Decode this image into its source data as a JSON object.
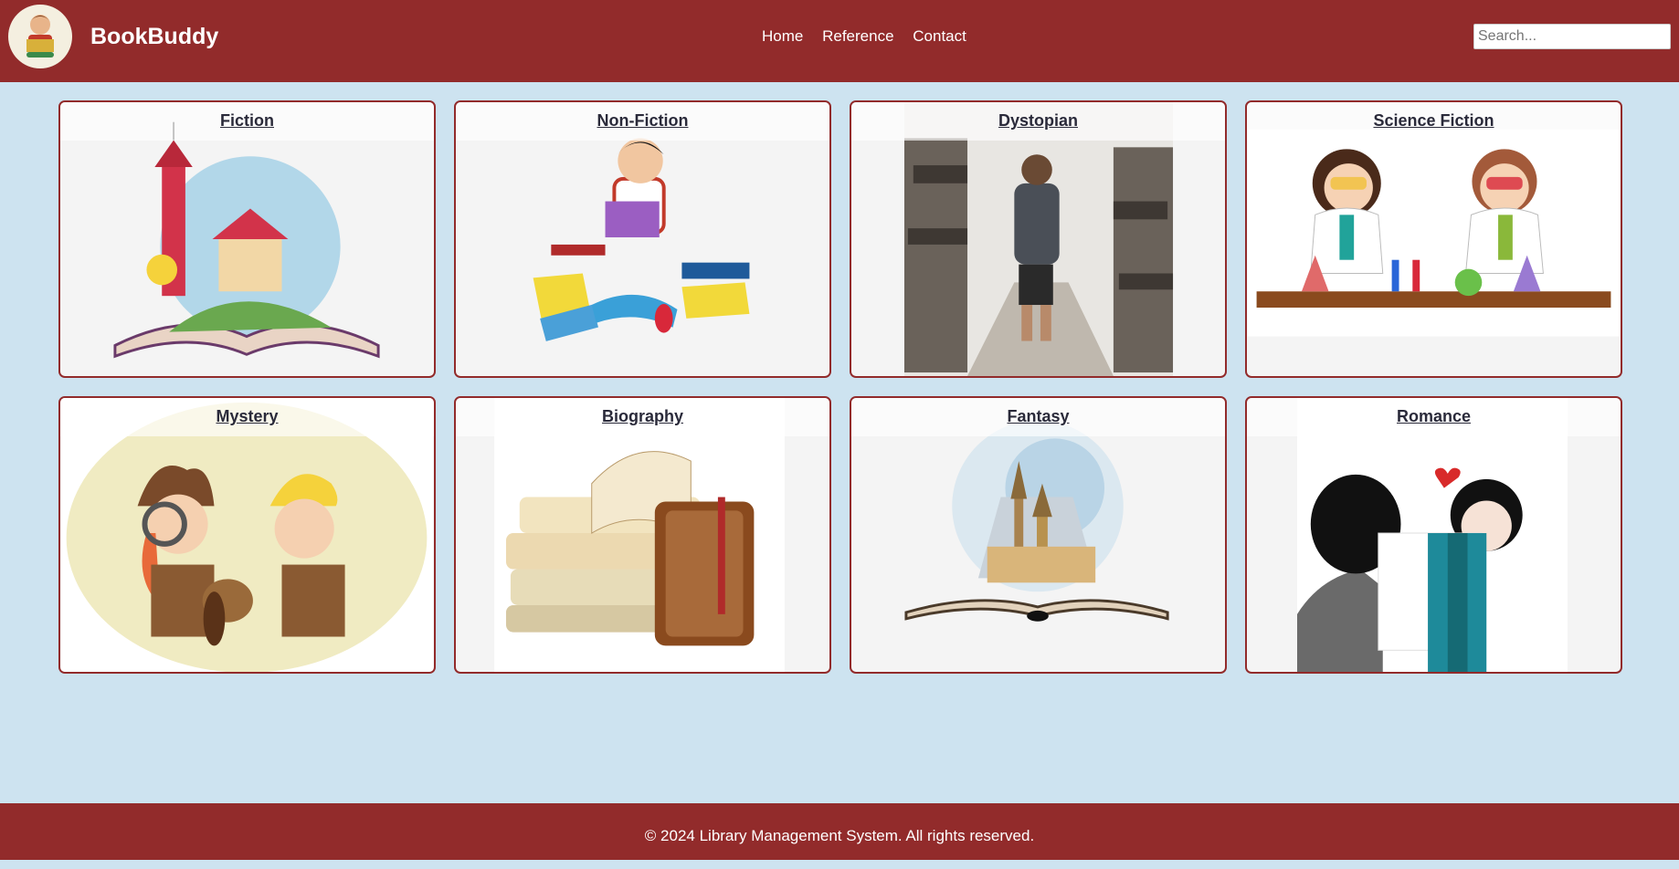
{
  "header": {
    "brand": "BookBuddy",
    "nav": [
      "Home",
      "Reference",
      "Contact"
    ],
    "search_placeholder": "Search..."
  },
  "categories": [
    {
      "label": "Fiction",
      "illustration": "open-book-castle-illustration"
    },
    {
      "label": "Non-Fiction",
      "illustration": "reading-boy-illustration"
    },
    {
      "label": "Dystopian",
      "illustration": "boy-ruins-illustration"
    },
    {
      "label": "Science Fiction",
      "illustration": "kids-lab-illustration"
    },
    {
      "label": "Mystery",
      "illustration": "detectives-illustration"
    },
    {
      "label": "Biography",
      "illustration": "old-books-illustration"
    },
    {
      "label": "Fantasy",
      "illustration": "magic-book-castle-illustration"
    },
    {
      "label": "Romance",
      "illustration": "couple-kiss-book-illustration"
    }
  ],
  "footer": {
    "text": "© 2024 Library Management System. All rights reserved."
  },
  "colors": {
    "primary": "#922b2b",
    "background": "#cde3f0",
    "card_bg": "#f4f4f4"
  }
}
